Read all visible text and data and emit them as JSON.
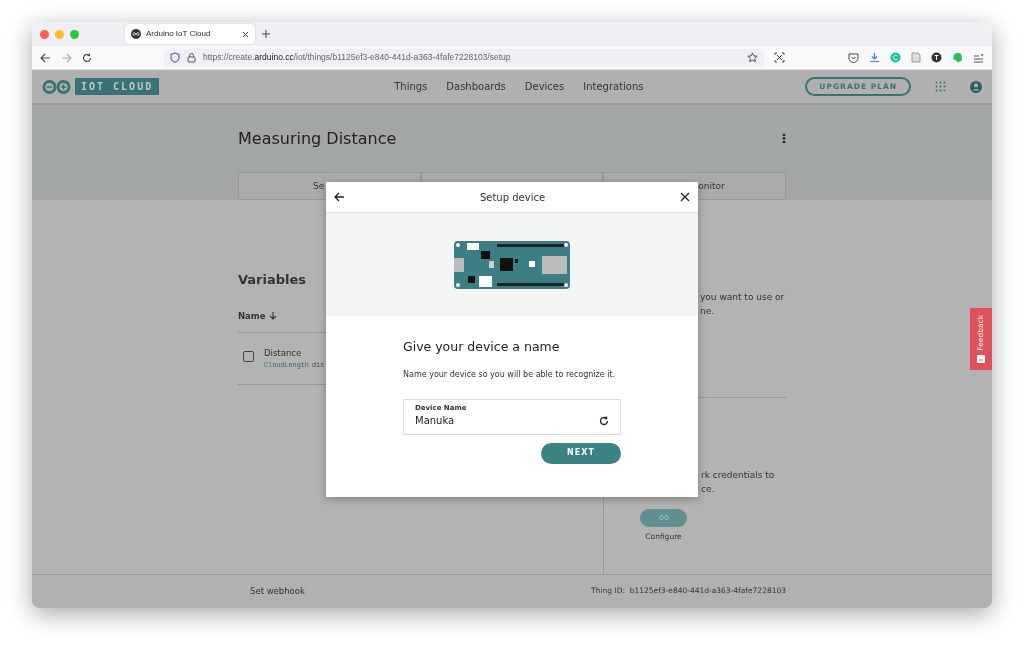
{
  "browser": {
    "tab": {
      "title": "Arduino IoT Cloud"
    },
    "url": "https://create.**arduino.cc**/iot/things/b1125ef3-e840-441d-a363-4fafe7228103/setup"
  },
  "app": {
    "logo": "IOT CLOUD",
    "nav": [
      {
        "label": "Things"
      },
      {
        "label": "Dashboards"
      },
      {
        "label": "Devices"
      },
      {
        "label": "Integrations"
      }
    ],
    "upgrade_button": "UPGRADE PLAN"
  },
  "thing": {
    "title": "Measuring Distance",
    "tabs": [
      {
        "label": "Se"
      },
      {
        "label": "onitor"
      }
    ]
  },
  "variables": {
    "title": "Variables",
    "column": "Name",
    "rows": [
      {
        "checked": false,
        "name": "Distance",
        "type": "CloudLength",
        "description": "dis"
      }
    ]
  },
  "side_panel": {
    "device_text": [
      "you want to use or",
      "ne."
    ],
    "network_text": [
      "rk credentials to",
      "ce."
    ],
    "configure_label": "Configure"
  },
  "footer": {
    "webhook": "Set webhook",
    "thing_id": "Thing ID:  b1125ef3-e840-441d-a363-4fafe7228103"
  },
  "feedback": "Feedback",
  "modal": {
    "title": "Setup device",
    "heading": "Give your device a name",
    "description": "Name your device so you will be able to recognize it.",
    "field": {
      "label": "Device Name",
      "value": "Manuka"
    },
    "next_button": "NEXT"
  }
}
